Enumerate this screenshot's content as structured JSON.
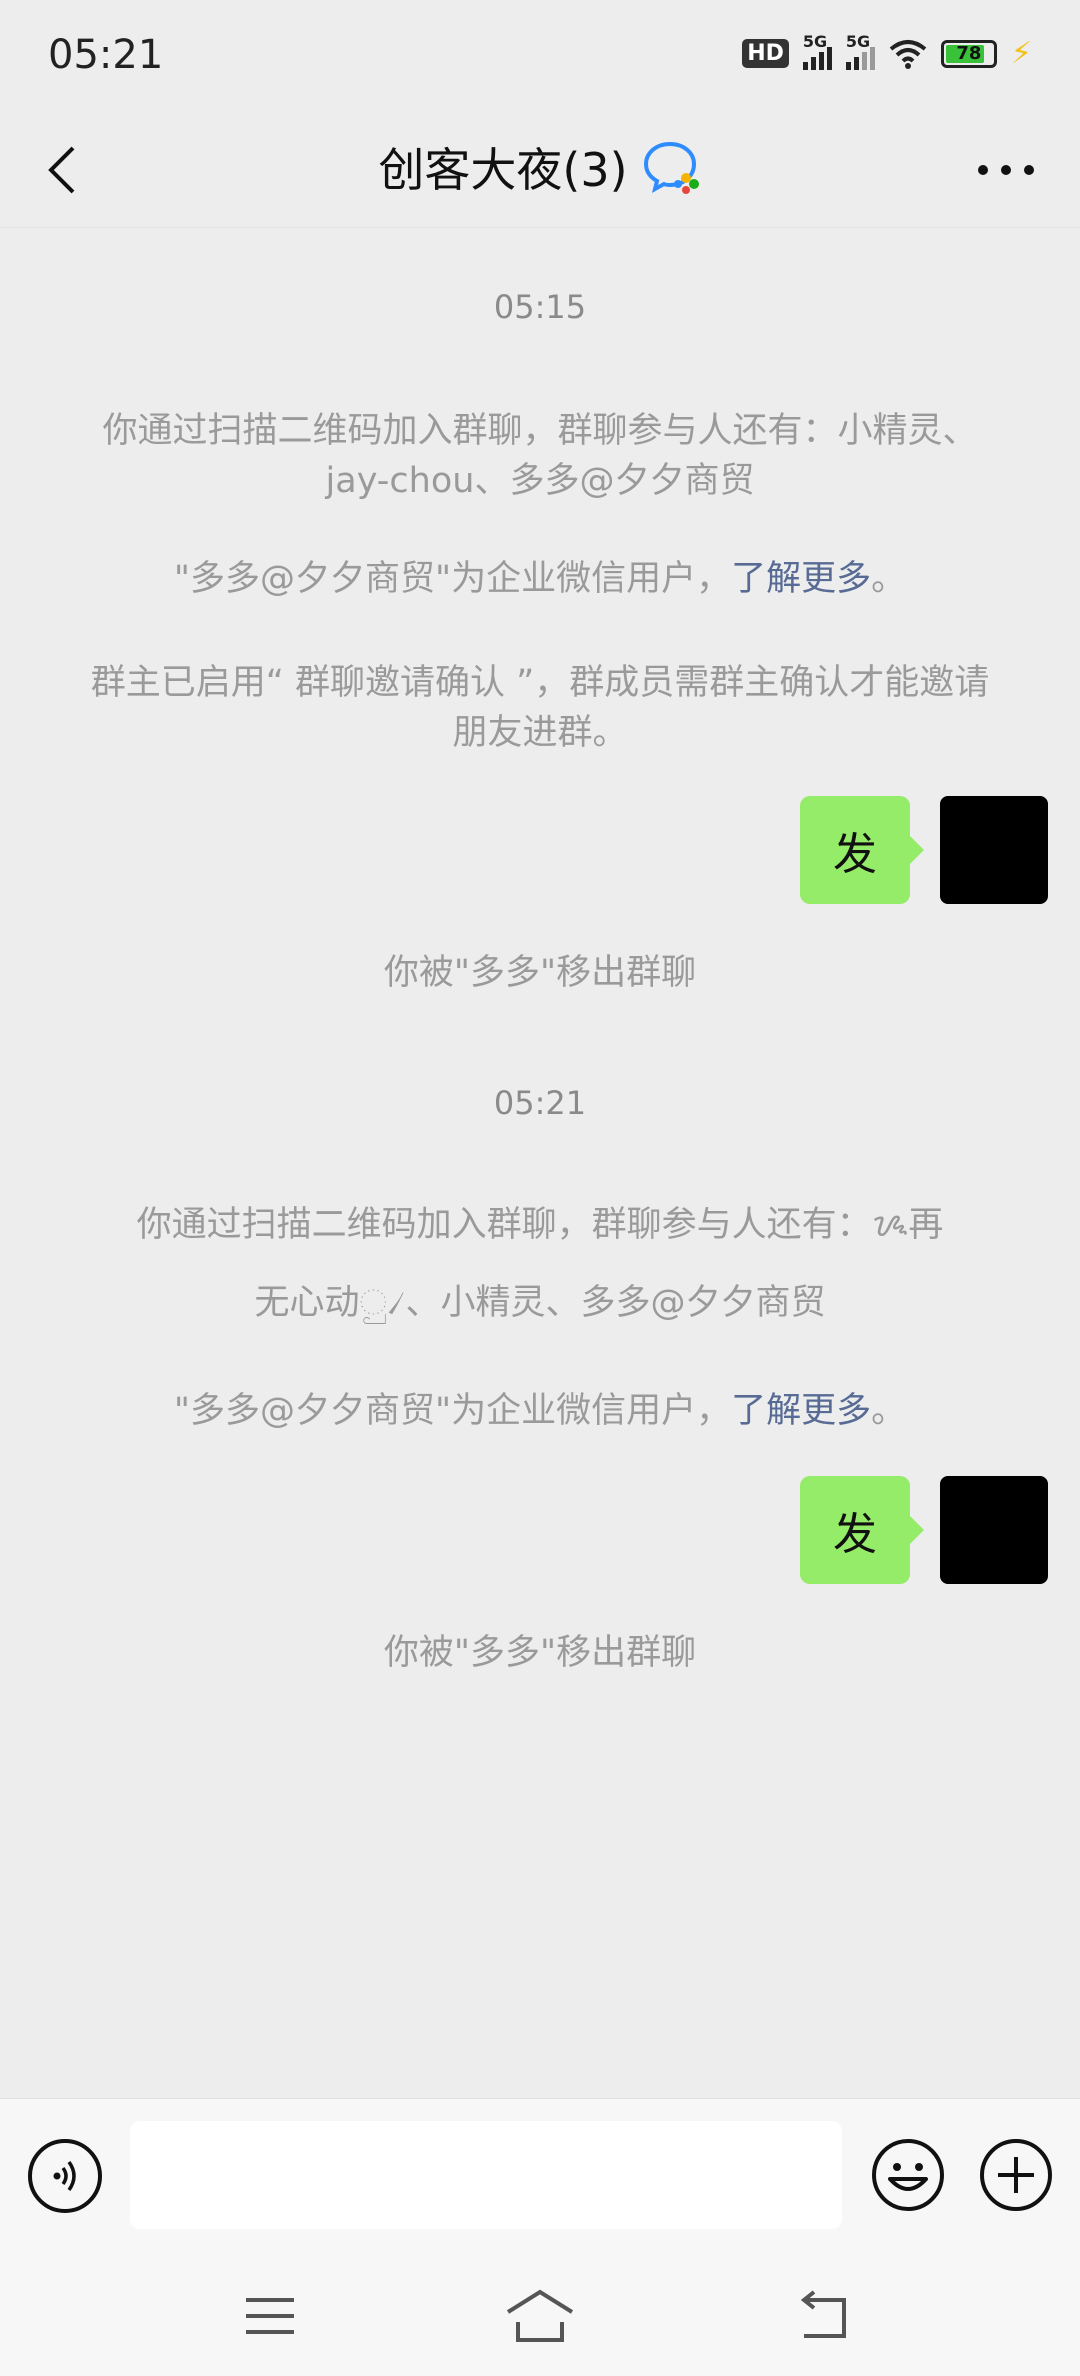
{
  "status_bar": {
    "time": "05:21",
    "hd_label": "HD",
    "net1": "5G",
    "net2": "5G",
    "battery": "78"
  },
  "header": {
    "title": "创客大夜(3)"
  },
  "messages": {
    "ts1": "05:15",
    "sys1": "你通过扫描二维码加入群聊，群聊参与人还有：小精灵、jay-chou、多多@夕夕商贸",
    "sys2_text": "\"多多@夕夕商贸\"为企业微信用户，",
    "sys2_link": "了解更多",
    "sys2_end": "。",
    "sys3": "群主已启用“ 群聊邀请确认 ”，群成员需群主确认才能邀请朋友进群。",
    "bubble1": "发",
    "sys4": "你被\"多多\"移出群聊",
    "ts2": "05:21",
    "sys5": "你通过扫描二维码加入群聊，群聊参与人还有：ᝰ再",
    "sys5b": "无心动ු৴、小精灵、多多@夕夕商贸",
    "sys6_text": "\"多多@夕夕商贸\"为企业微信用户，",
    "sys6_link": "了解更多",
    "sys6_end": "。",
    "bubble2": "发",
    "sys7": "你被\"多多\"移出群聊"
  },
  "input": {
    "placeholder": ""
  },
  "colors": {
    "background": "#ededed",
    "bubble": "#95ec69",
    "link": "#576b95",
    "system_text": "#9a9a9a"
  }
}
